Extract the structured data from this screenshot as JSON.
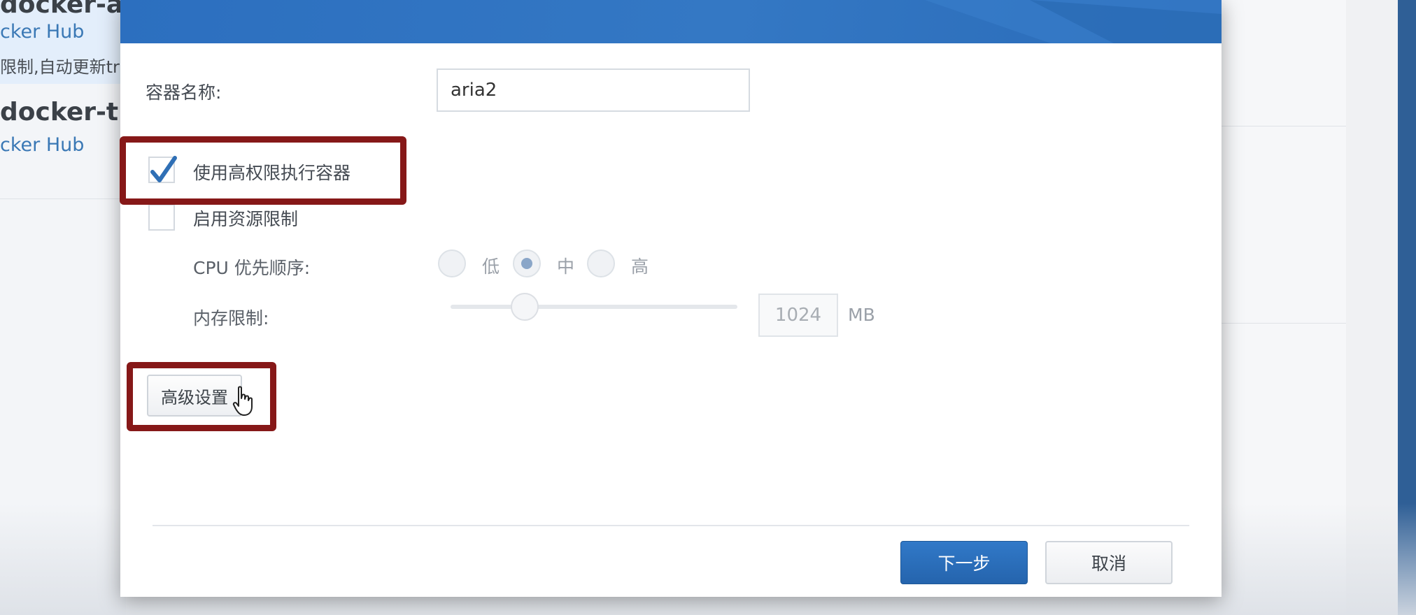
{
  "background_list": {
    "items": [
      {
        "title": "docker-ar",
        "source": "cker Hub",
        "description": "限制,自动更新tra"
      },
      {
        "title": "docker-th",
        "source": "cker Hub"
      }
    ]
  },
  "dialog": {
    "container_name_label": "容器名称:",
    "container_name_value": "aria2",
    "privileged_checkbox": {
      "label": "使用高权限执行容器",
      "checked": true
    },
    "resource_limit_checkbox": {
      "label": "启用资源限制",
      "checked": false
    },
    "cpu_priority": {
      "label": "CPU 优先顺序:",
      "options": [
        "低",
        "中",
        "高"
      ],
      "selected": "中"
    },
    "memory_limit": {
      "label": "内存限制:",
      "value": "1024",
      "unit": "MB"
    },
    "advanced_settings_button": "高级设置",
    "next_button": "下一步",
    "cancel_button": "取消"
  },
  "colors": {
    "header_blue": "#2c6fbf",
    "highlight_red": "#861818",
    "primary_button": "#2a6bb8"
  }
}
